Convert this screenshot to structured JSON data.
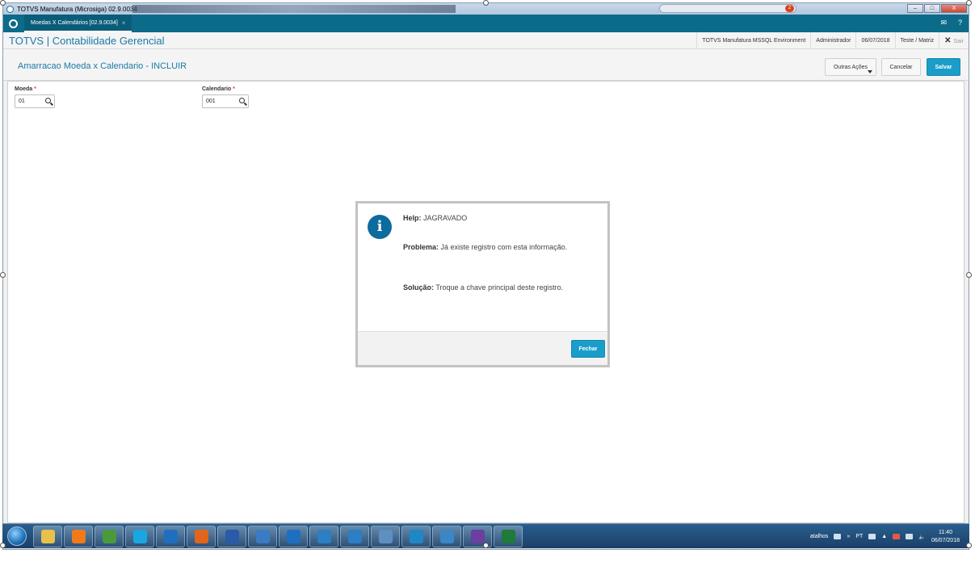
{
  "window": {
    "title": "TOTVS Manufatura (Microsiga) 02.9.0034",
    "notification_count": "2",
    "controls": {
      "minimize": "–",
      "maximize": "□",
      "close": "X"
    }
  },
  "tabs": [
    {
      "label": "Moedas X Calendários [02.9.0034]",
      "close": "×"
    }
  ],
  "topbar_icons": {
    "mail": "✉",
    "help": "?"
  },
  "app_header": {
    "title": "TOTVS | Contabilidade Gerencial",
    "environment": "TOTVS Manufatura MSSQL Environment",
    "user": "Administrador",
    "date": "06/07/2018",
    "branch": "Teste / Matriz",
    "exit_label": "Sair",
    "exit_icon": "✕"
  },
  "form_header": {
    "title": "Amarracao Moeda x Calendario - INCLUIR",
    "buttons": {
      "more_actions": "Outras Ações",
      "cancel": "Cancelar",
      "save": "Salvar"
    }
  },
  "fields": {
    "moeda": {
      "label": "Moeda",
      "required": "*",
      "value": "01"
    },
    "calendario": {
      "label": "Calendario",
      "required": "*",
      "value": "001"
    }
  },
  "dialog": {
    "icon_glyph": "i",
    "help_label": "Help:",
    "help_value": "JAGRAVADO",
    "problem_label": "Problema:",
    "problem_value": "Já existe registro com esta informação.",
    "solution_label": "Solução:",
    "solution_value": "Troque a chave principal deste registro.",
    "close_button": "Fechar"
  },
  "taskbar": {
    "tray_label": "atalhos",
    "tray_lang": "PT",
    "tray_arrows": "»",
    "tray_up": "▲",
    "tray_volume": "🔈",
    "time": "11:40",
    "date": "06/07/2018",
    "apps": [
      {
        "icon": "file-explorer-icon",
        "color": "#e8c14a"
      },
      {
        "icon": "media-player-icon",
        "color": "#f07a1a"
      },
      {
        "icon": "chrome-icon",
        "color": "#4a9a3c"
      },
      {
        "icon": "skype-icon",
        "color": "#1aa6e0"
      },
      {
        "icon": "outlook-icon",
        "color": "#1e6fc0"
      },
      {
        "icon": "firefox-icon",
        "color": "#e2651c"
      },
      {
        "icon": "word-icon",
        "color": "#2b5aa8"
      },
      {
        "icon": "remote-assist-icon",
        "color": "#3b7bc4"
      },
      {
        "icon": "outlook-alt-icon",
        "color": "#1e6fc0"
      },
      {
        "icon": "network-icon",
        "color": "#2b7fc2"
      },
      {
        "icon": "remote-desktop-icon",
        "color": "#2b7fc2"
      },
      {
        "icon": "monitor-icon",
        "color": "#5e8fc1"
      },
      {
        "icon": "totvs-icon",
        "color": "#1e88c7"
      },
      {
        "icon": "compass-icon",
        "color": "#3b86c4"
      },
      {
        "icon": "visual-studio-icon",
        "color": "#6a3fa0"
      },
      {
        "icon": "excel-icon",
        "color": "#1f7a3c"
      }
    ]
  }
}
